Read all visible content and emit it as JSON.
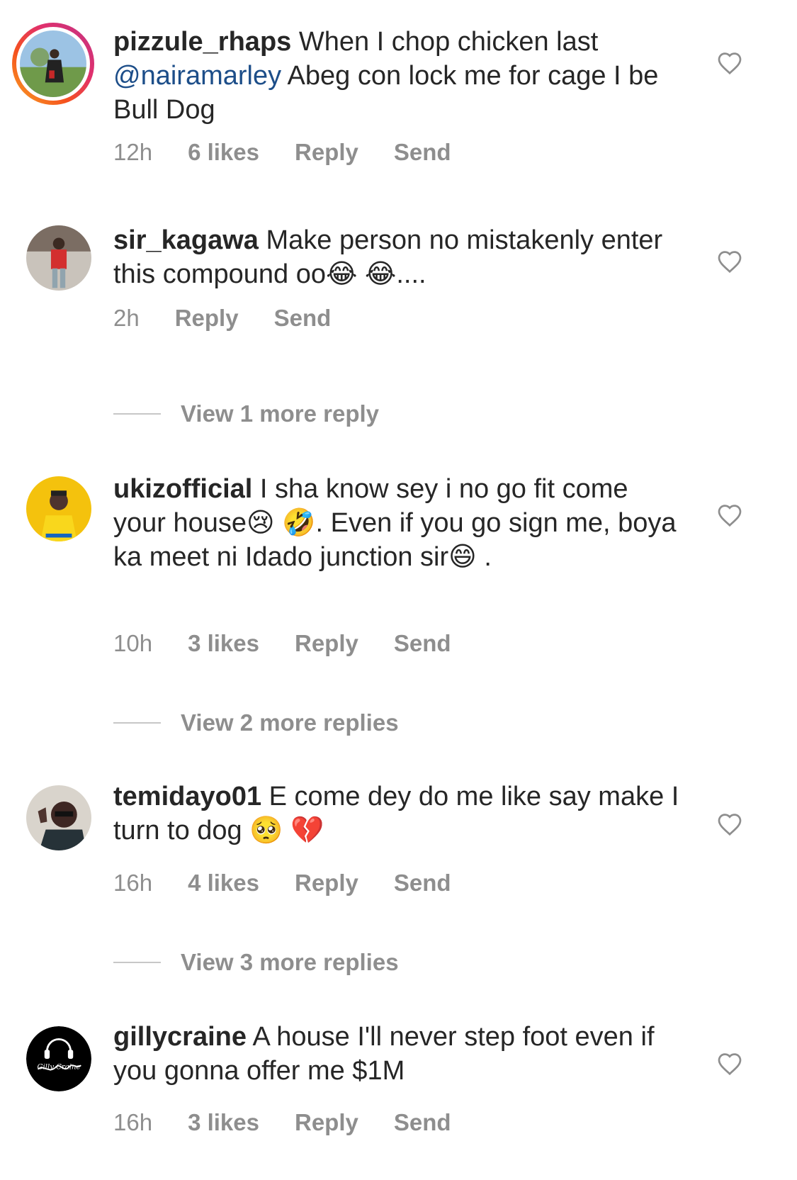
{
  "comments": [
    {
      "username": "pizzule_rhaps",
      "text_before": " When I chop chicken last ",
      "mention": "@nairamarley",
      "text_after": " Abeg con lock me for cage I be Bull Dog",
      "time": "12h",
      "likes": "6 likes",
      "reply": "Reply",
      "send": "Send"
    },
    {
      "username": "sir_kagawa",
      "text": " Make person no mistakenly enter this compound oo😂 😂....",
      "time": "2h",
      "reply": "Reply",
      "send": "Send",
      "view_more": "View 1 more reply"
    },
    {
      "username": "ukizofficial",
      "text": " I sha know sey i no go fit come your house😢 🤣. Even if you go sign me, boya ka meet ni Idado junction sir😄 .",
      "time": "10h",
      "likes": "3 likes",
      "reply": "Reply",
      "send": "Send",
      "view_more": "View 2 more replies"
    },
    {
      "username": "temidayo01",
      "text": " E come dey do me like say make I turn to dog 🥺 💔",
      "time": "16h",
      "likes": "4 likes",
      "reply": "Reply",
      "send": "Send",
      "view_more": "View 3 more replies"
    },
    {
      "username": "gillycraine",
      "text": " A house I'll never step foot even if you gonna offer me $1M",
      "time": "16h",
      "likes": "3 likes",
      "reply": "Reply",
      "send": "Send",
      "avatar_logo": "GillyCraine"
    }
  ],
  "colors": {
    "text": "#262626",
    "meta": "#8e8e8e",
    "mention": "#1d4e89",
    "story_ring": [
      "#f9a825",
      "#e1306c",
      "#c13584"
    ]
  },
  "icons": {
    "like": "heart-outline-icon"
  }
}
